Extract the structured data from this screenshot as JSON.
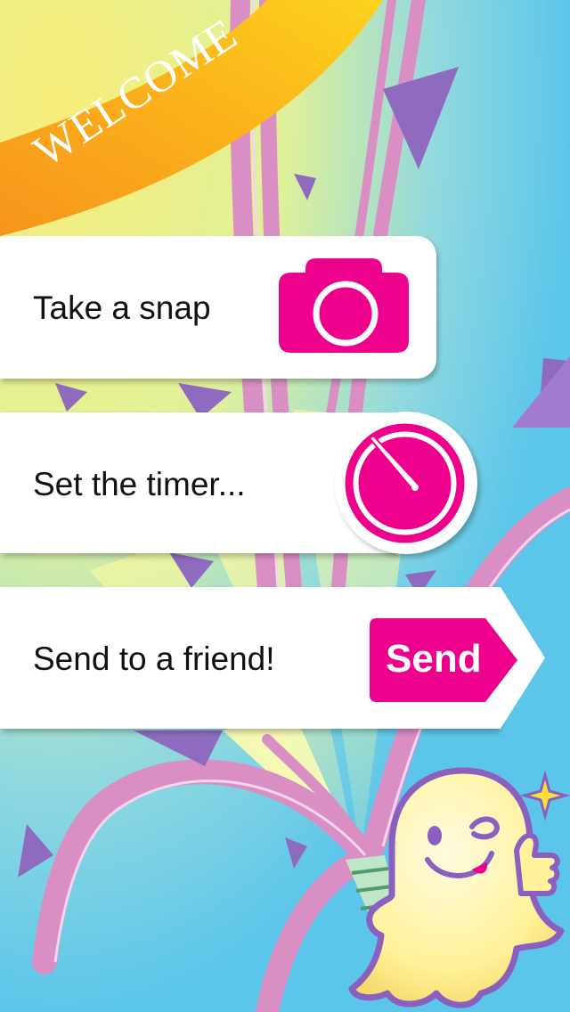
{
  "banner": {
    "welcome": "WELCOME"
  },
  "cards": {
    "snap": {
      "label": "Take a snap",
      "icon": "camera-icon"
    },
    "timer": {
      "label": "Set the timer...",
      "icon": "timer-icon"
    },
    "send": {
      "label": "Send to a friend!",
      "button_label": "Send"
    }
  },
  "colors": {
    "accent_pink": "#ec008c",
    "background_blue": "#5cc6ea",
    "banner_yellow": "#fcd21e",
    "banner_orange": "#f7941d",
    "ribbon_purple": "#8e6bbf",
    "ribbon_pink": "#d98fc4",
    "ghost_yellow": "#fff29a"
  }
}
